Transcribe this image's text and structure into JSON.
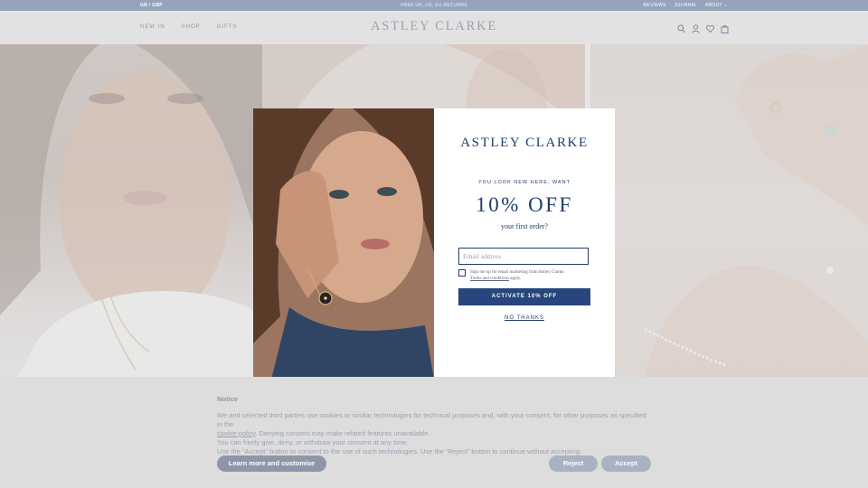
{
  "topbar": {
    "locale": "GB / GBP",
    "promo": "FREE UK, US, EU RETURNS",
    "links": [
      "REVIEWS",
      "JOURNAL",
      "ABOUT"
    ]
  },
  "header": {
    "nav": [
      "NEW IN",
      "SHOP",
      "GIFTS"
    ],
    "logo": "ASTLEY CLARKE",
    "icons": [
      "search-icon",
      "account-icon",
      "wishlist-heart-icon",
      "bag-icon"
    ]
  },
  "modal": {
    "logo": "ASTLEY CLARKE",
    "kicker": "YOU LOOK NEW HERE, WANT",
    "headline": "10% OFF",
    "subline": "your first order?",
    "email_placeholder": "Email address",
    "consent_text": "Sign me up for email marketing from Astley Clarke.",
    "terms_link": "Terms and conditions",
    "terms_suffix": " apply.",
    "activate_label": "ACTIVATE 10% OFF",
    "no_thanks_label": "NO THANKS"
  },
  "notice": {
    "title": "Notice",
    "line1": "We and selected third parties use cookies or similar technologies for technical purposes and, with your consent, for other purposes as specified in the",
    "cookie_policy": "cookie policy",
    "line1b": ". Denying consent may make related features unavailable.",
    "line2": "You can freely give, deny, or withdraw your consent at any time.",
    "line3": "Use the “Accept” button to consent to the use of such technologies. Use the “Reject” button to continue without accepting.",
    "learn_label": "Learn more and customise",
    "reject_label": "Reject",
    "accept_label": "Accept"
  },
  "colors": {
    "brand_navy": "#1f3d6b",
    "activate_button": "#27467d",
    "topbar": "#97a3bb"
  }
}
